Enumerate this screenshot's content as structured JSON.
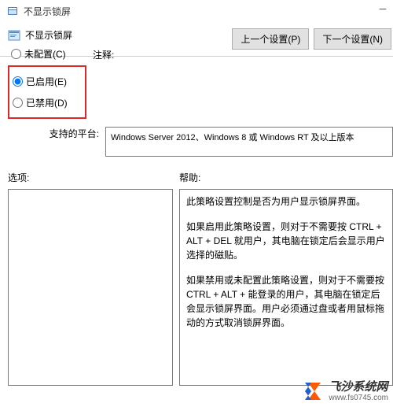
{
  "window": {
    "title": "不显示锁屏"
  },
  "header": {
    "policy_title": "不显示锁屏"
  },
  "nav": {
    "prev": "上一个设置(P)",
    "next": "下一个设置(N)"
  },
  "radios": {
    "not_configured": "未配置(C)",
    "enabled": "已启用(E)",
    "disabled": "已禁用(D)"
  },
  "comment": {
    "label": "注释:"
  },
  "supported": {
    "label": "支持的平台:",
    "value": "Windows Server 2012、Windows 8 或 Windows RT 及以上版本"
  },
  "options": {
    "label": "选项:"
  },
  "help": {
    "label": "帮助:",
    "p1": "此策略设置控制是否为用户显示锁屏界面。",
    "p2": "如果启用此策略设置，则对于不需要按 CTRL + ALT + DEL  就用户，其电脑在锁定后会显示用户选择的磁贴。",
    "p3": "如果禁用或未配置此策略设置，则对于不需要按 CTRL + ALT + 能登录的用户，其电脑在锁定后会显示锁屏界面。用户必须通过盘或者用鼠标拖动的方式取消锁屏界面。"
  },
  "watermark": {
    "title": "飞沙系统网",
    "url": "www.fs0745.com"
  }
}
